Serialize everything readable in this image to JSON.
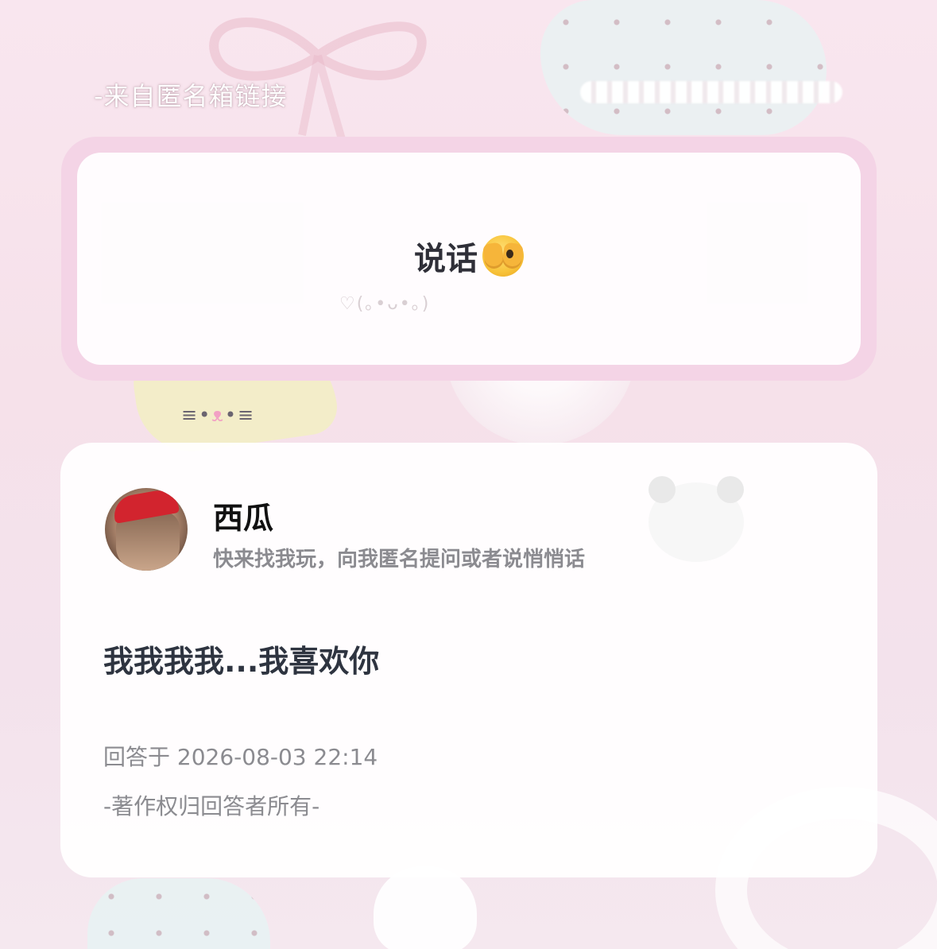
{
  "header": {
    "source_label": "-来自匿名箱链接"
  },
  "question": {
    "text": "说话",
    "emoji_icon": "face-with-open-eyes-and-hand-over-mouth-icon"
  },
  "profile": {
    "name": "西瓜",
    "bio": "快来找我玩，向我匿名提问或者说悄悄话"
  },
  "answer": {
    "text": "我我我我...我喜欢你",
    "answered_time": "回答于 2026-08-03 22:14",
    "copyright": "-著作权归回答者所有-"
  },
  "colors": {
    "card_border": "#f4d4e6",
    "background": "#f6e1ea",
    "text_dark": "#2e3440",
    "text_muted": "#8b8b90"
  }
}
